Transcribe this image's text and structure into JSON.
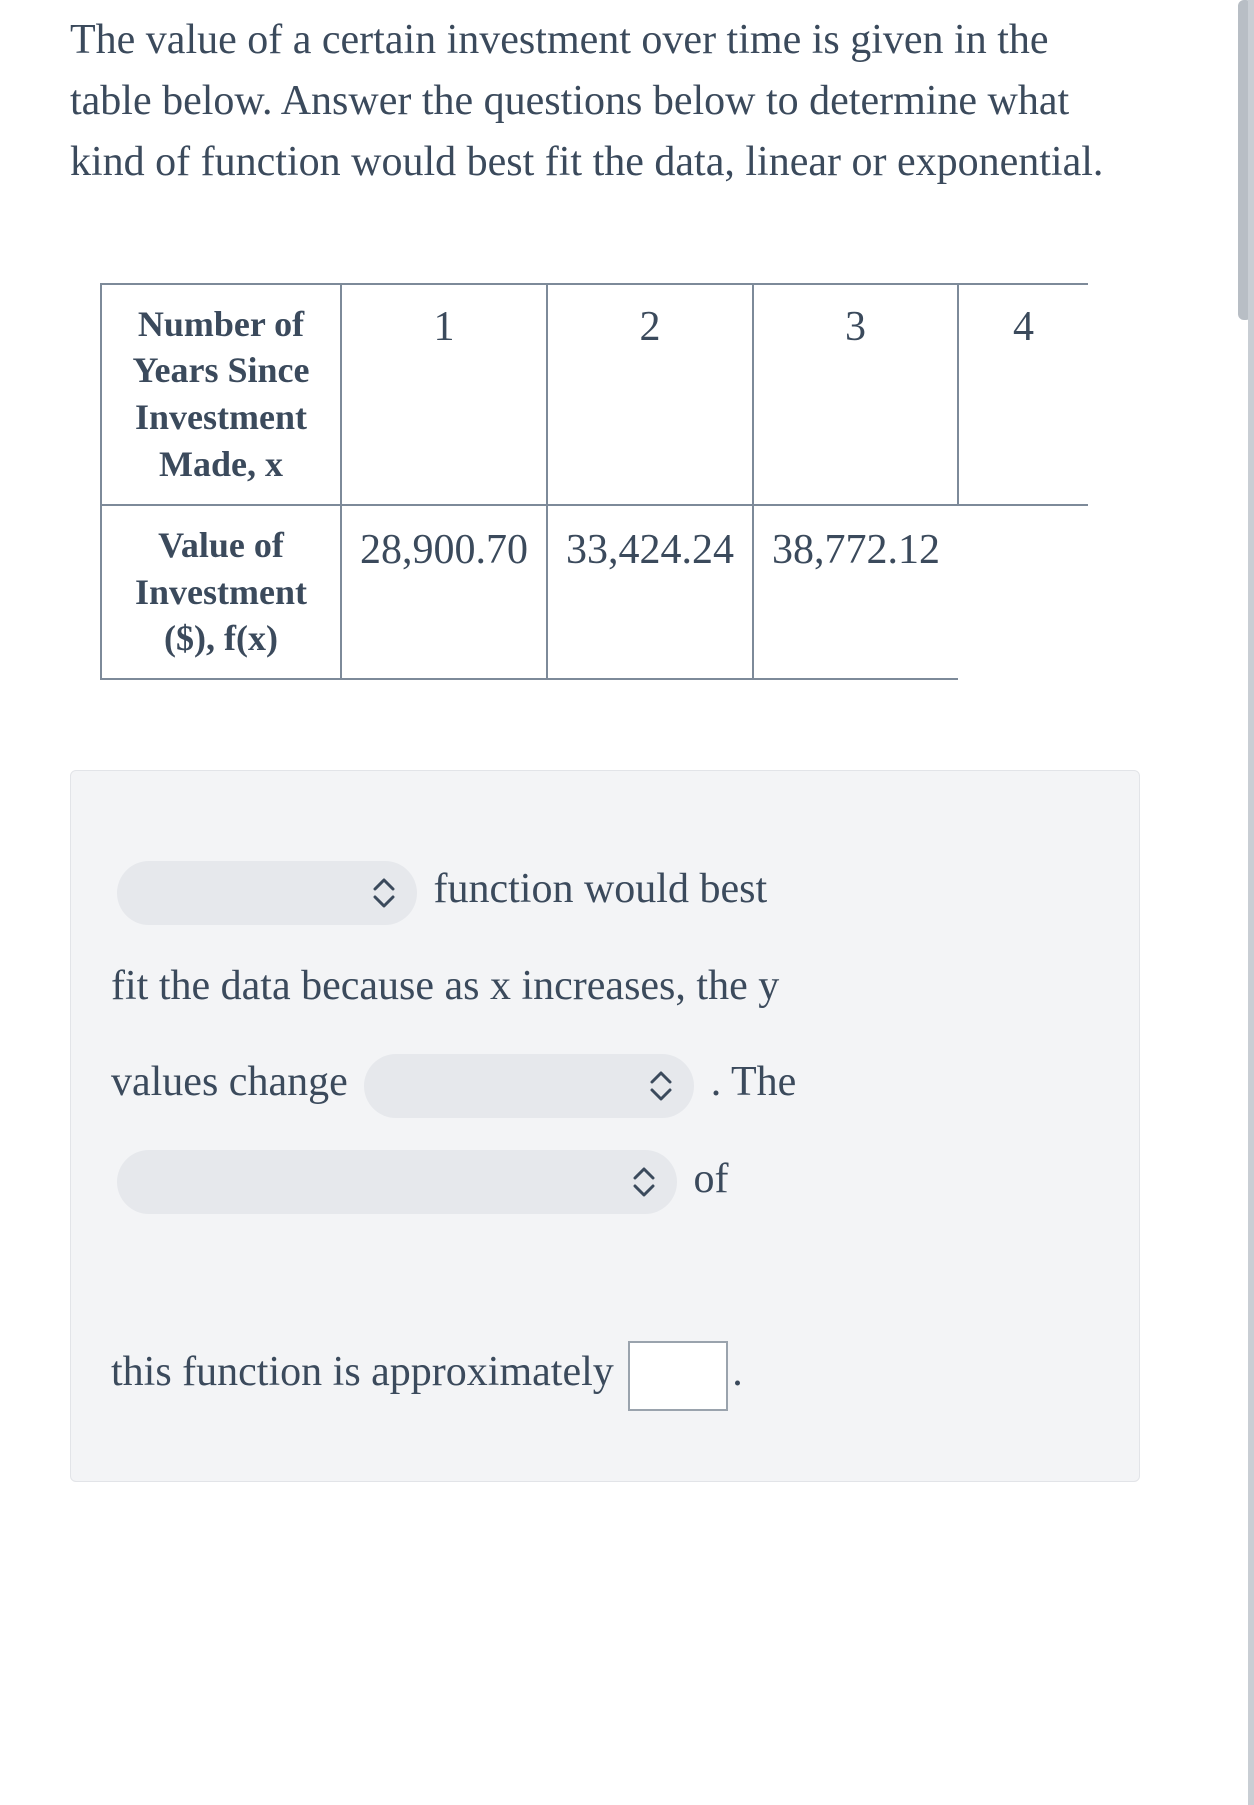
{
  "question": "The value of a certain investment over time is given in the table below. Answer the questions below to determine what kind of function would best fit the data, linear or exponential.",
  "table": {
    "row1_label": "Number of Years Since Investment Made, x",
    "years": [
      "1",
      "2",
      "3",
      "4"
    ],
    "row2_label": "Value of Investment ($), f(x)",
    "values": [
      "28,900.70",
      "33,424.24",
      "38,772.12"
    ]
  },
  "answer": {
    "t1": " function would best",
    "t2": "fit the data because as x increases, the y",
    "t3": "values change ",
    "t4": " . The",
    "t5": " of",
    "t6": "this function is approximately ",
    "t7": "."
  }
}
